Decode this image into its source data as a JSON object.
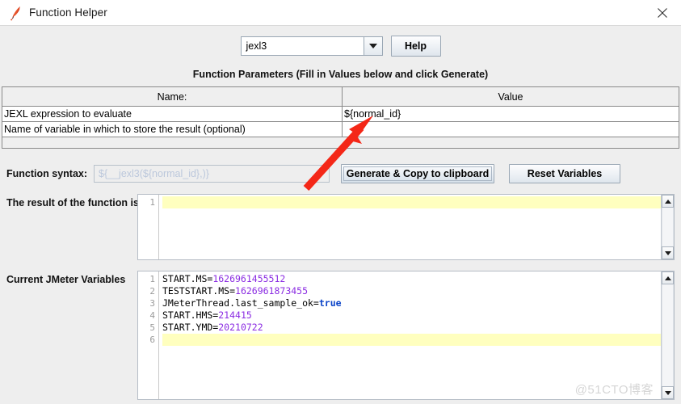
{
  "window": {
    "title": "Function Helper",
    "app_icon": "jmeter-feather-icon",
    "close_icon": "close-icon"
  },
  "toolbar": {
    "function_select_value": "jexl3",
    "function_select_icon": "chevron-down-icon",
    "help_label": "Help"
  },
  "parameters": {
    "section_title": "Function Parameters (Fill in Values below and click Generate)",
    "columns": [
      "Name:",
      "Value"
    ],
    "rows": [
      {
        "name": "JEXL expression to evaluate",
        "value": "${normal_id}"
      },
      {
        "name": "Name of variable in which to store the result (optional)",
        "value": ""
      }
    ]
  },
  "syntax": {
    "label": "Function syntax:",
    "value": "${__jexl3(${normal_id},)}",
    "generate_label": "Generate & Copy to clipboard",
    "reset_label": "Reset Variables"
  },
  "result": {
    "label": "The result of the function is",
    "line_numbers": [
      "1"
    ],
    "lines": [
      ""
    ],
    "current_line": 1
  },
  "variables": {
    "label": "Current JMeter Variables",
    "line_numbers": [
      "1",
      "2",
      "3",
      "4",
      "5",
      "6"
    ],
    "entries": [
      {
        "key": "START.MS=",
        "value": "1626961455512",
        "value_type": "number"
      },
      {
        "key": "TESTSTART.MS=",
        "value": "1626961873455",
        "value_type": "number"
      },
      {
        "key": "JMeterThread.last_sample_ok=",
        "value": "true",
        "value_type": "boolean"
      },
      {
        "key": "START.HMS=",
        "value": "214415",
        "value_type": "number"
      },
      {
        "key": "START.YMD=",
        "value": "20210722",
        "value_type": "number"
      }
    ],
    "current_line": 6
  },
  "annotation": {
    "arrow_color": "#f42717",
    "arrow_name": "red-arrow-annotation"
  },
  "watermark": {
    "text": "@51CTO博客"
  },
  "colors": {
    "background": "#eeeeee",
    "highlight_line": "#ffffbf",
    "number_value": "#8a2be2",
    "boolean_value": "#0b44c8",
    "placeholder": "#bcc8dc"
  }
}
